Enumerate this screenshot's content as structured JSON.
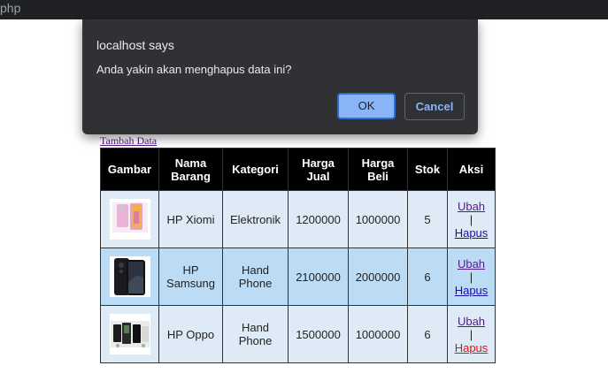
{
  "browser": {
    "url_fragment": "php"
  },
  "dialog": {
    "title": "localhost says",
    "message": "Anda yakin akan menghapus data ini?",
    "ok_label": "OK",
    "cancel_label": "Cancel"
  },
  "page": {
    "add_link": "Tambah Data"
  },
  "table": {
    "headers": {
      "gambar": "Gambar",
      "nama_1": "Nama",
      "nama_2": "Barang",
      "kategori": "Kategori",
      "jual_1": "Harga",
      "jual_2": "Jual",
      "beli_1": "Harga",
      "beli_2": "Beli",
      "stok": "Stok",
      "aksi": "Aksi"
    },
    "rows": [
      {
        "nama_1": "HP Xiomi",
        "nama_2": "",
        "kategori_1": "Elektronik",
        "kategori_2": "",
        "harga_jual": "1200000",
        "harga_beli": "1000000",
        "stok": "5",
        "ubah": "Ubah",
        "sep": "|",
        "hapus": "Hapus",
        "image_icon": "phone-pink-image"
      },
      {
        "nama_1": "HP",
        "nama_2": "Samsung",
        "kategori_1": "Hand",
        "kategori_2": "Phone",
        "harga_jual": "2100000",
        "harga_beli": "2000000",
        "stok": "6",
        "ubah": "Ubah",
        "sep": "|",
        "hapus": "Hapus",
        "image_icon": "phone-black-image"
      },
      {
        "nama_1": "HP Oppo",
        "nama_2": "",
        "kategori_1": "Hand",
        "kategori_2": "Phone",
        "harga_jual": "1500000",
        "harga_beli": "1000000",
        "stok": "6",
        "ubah": "Ubah",
        "sep": "|",
        "hapus": "Hapus",
        "image_icon": "phone-set-image"
      }
    ]
  },
  "colors": {
    "header_bg": "#000000",
    "row_light": "#deebf7",
    "row_blue": "#bcdcf5",
    "dialog_bg": "#303134",
    "ok_bg": "#8ab4f8",
    "hapus_active": "#e01010"
  }
}
